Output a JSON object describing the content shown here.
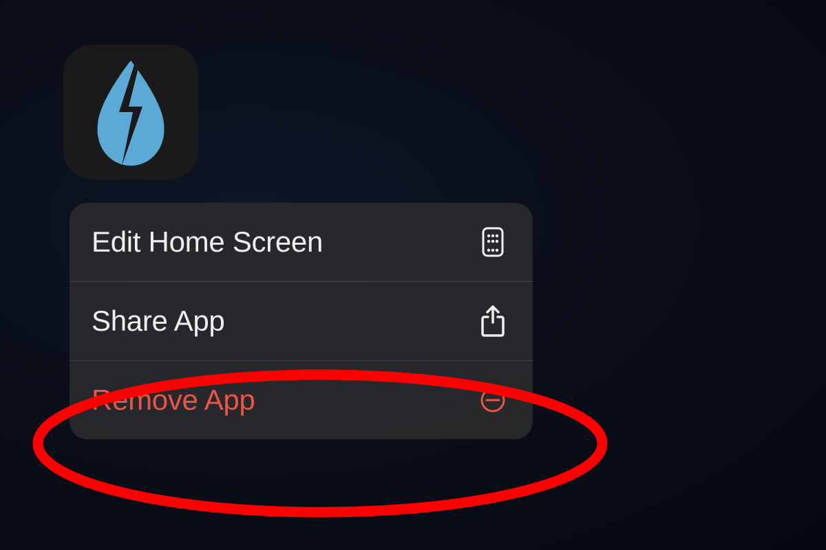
{
  "app": {
    "icon_name": "weather-bolt-droplet-icon",
    "icon_colors": {
      "droplet": "#5aa9d6",
      "bolt_bg": "#1a1a1a"
    }
  },
  "context_menu": {
    "items": [
      {
        "label": "Edit Home Screen",
        "icon": "grid-phone-icon",
        "destructive": false
      },
      {
        "label": "Share App",
        "icon": "share-icon",
        "destructive": false
      },
      {
        "label": "Remove App",
        "icon": "minus-circle-icon",
        "destructive": true
      }
    ]
  },
  "annotation": {
    "color": "#ff0000",
    "target_index": 2
  }
}
